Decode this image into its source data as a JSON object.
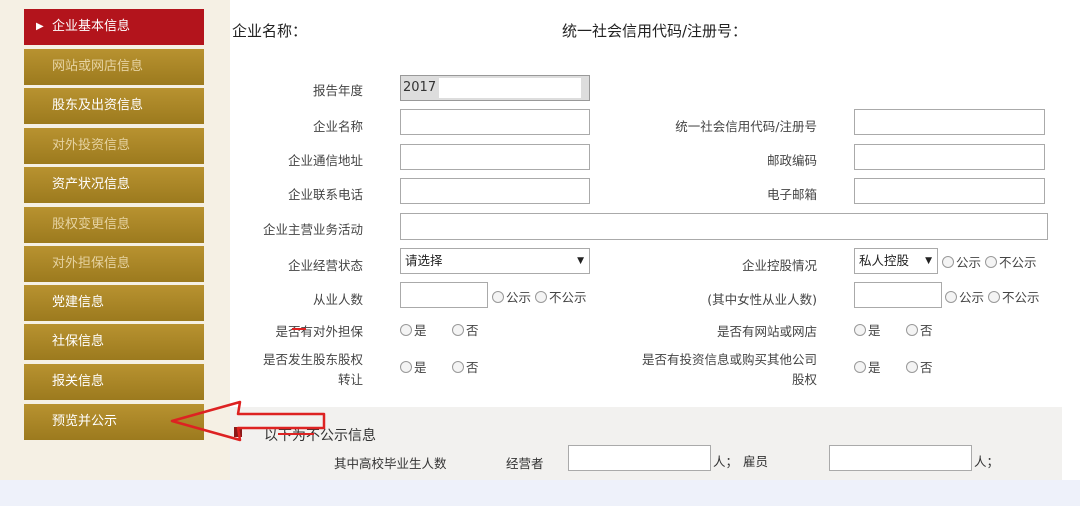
{
  "sidebar": {
    "items": [
      {
        "label": "企业基本信息"
      },
      {
        "label": "网站或网店信息"
      },
      {
        "label": "股东及出资信息"
      },
      {
        "label": "对外投资信息"
      },
      {
        "label": "资产状况信息"
      },
      {
        "label": "股权变更信息"
      },
      {
        "label": "对外担保信息"
      },
      {
        "label": "党建信息"
      },
      {
        "label": "社保信息"
      },
      {
        "label": "报关信息"
      },
      {
        "label": "预览并公示"
      }
    ]
  },
  "header": {
    "company_name_label": "企业名称：",
    "credit_code_label": "统一社会信用代码/注册号："
  },
  "form": {
    "report_year_label": "报告年度",
    "report_year_value": "2017",
    "company_name_label": "企业名称",
    "credit_code_label": "统一社会信用代码/注册号",
    "address_label": "企业通信地址",
    "postcode_label": "邮政编码",
    "phone_label": "企业联系电话",
    "email_label": "电子邮箱",
    "business_label": "企业主营业务活动",
    "status_label": "企业经营状态",
    "status_value": "请选择",
    "holding_label": "企业控股情况",
    "holding_value": "私人控股",
    "employees_label": "从业人数",
    "female_label": "(其中女性从业人数)",
    "guarantee_label": "是否有对外担保",
    "website_label": "是否有网站或网店",
    "equity_label_1": "是否发生股东股权",
    "equity_label_2": "转让",
    "invest_label_1": "是否有投资信息或购买其他公司",
    "invest_label_2": "股权",
    "public": "公示",
    "not_public": "不公示",
    "yes": "是",
    "no": "否"
  },
  "private_section": {
    "title": "以下为不公示信息",
    "grad_label": "其中高校毕业生人数",
    "operator_label": "经营者",
    "unit_sep": "人；",
    "employee_label": "雇员",
    "unit_end": "人；"
  },
  "colors": {
    "sidebar_gold": "#a8861f",
    "sidebar_active": "#b3141c",
    "annotation_red": "#dd2222"
  }
}
